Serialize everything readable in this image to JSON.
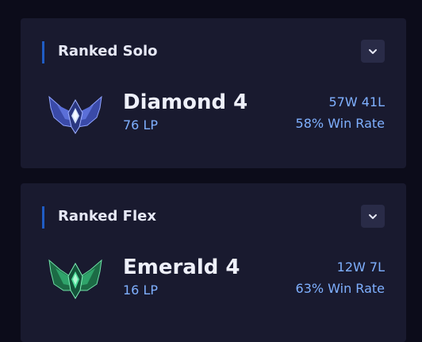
{
  "ranked": [
    {
      "queue": "Ranked Solo",
      "tier": "Diamond 4",
      "lp": "76 LP",
      "record": "57W 41L",
      "win_rate": "58% Win Rate",
      "emblem_icon": "diamond-emblem-icon",
      "emblem_color": "#5b6fd8"
    },
    {
      "queue": "Ranked Flex",
      "tier": "Emerald 4",
      "lp": "16 LP",
      "record": "12W 7L",
      "win_rate": "63% Win Rate",
      "emblem_icon": "emerald-emblem-icon",
      "emblem_color": "#2fa36a"
    }
  ],
  "colors": {
    "background": "#0c0c1a",
    "card": "#191a2f",
    "accent_bar": "#1f5cc4",
    "stat_text": "#7fb0ff",
    "title_text": "#e6e8f5"
  },
  "icons": {
    "expand": "chevron-down-icon"
  }
}
